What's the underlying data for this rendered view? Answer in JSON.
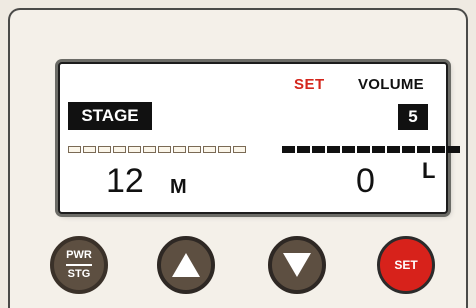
{
  "screen": {
    "set_indicator": "SET",
    "volume_label": "VOLUME",
    "stage_label": "STAGE",
    "volume_value": "5",
    "stage_number": "12",
    "stage_unit": "M",
    "volume_number": "0",
    "volume_unit": "L",
    "stage_bar": {
      "segments": 12,
      "filled": 0
    },
    "volume_bar": {
      "segments": 12,
      "filled": 12
    }
  },
  "buttons": {
    "pwr_top": "PWR",
    "pwr_bottom": "STG",
    "up_icon": "up-triangle-icon",
    "down_icon": "down-triangle-icon",
    "set_label": "SET"
  },
  "colors": {
    "accent_red": "#d7221b",
    "button_brown": "#5d4f41",
    "display_dark": "#111111"
  }
}
